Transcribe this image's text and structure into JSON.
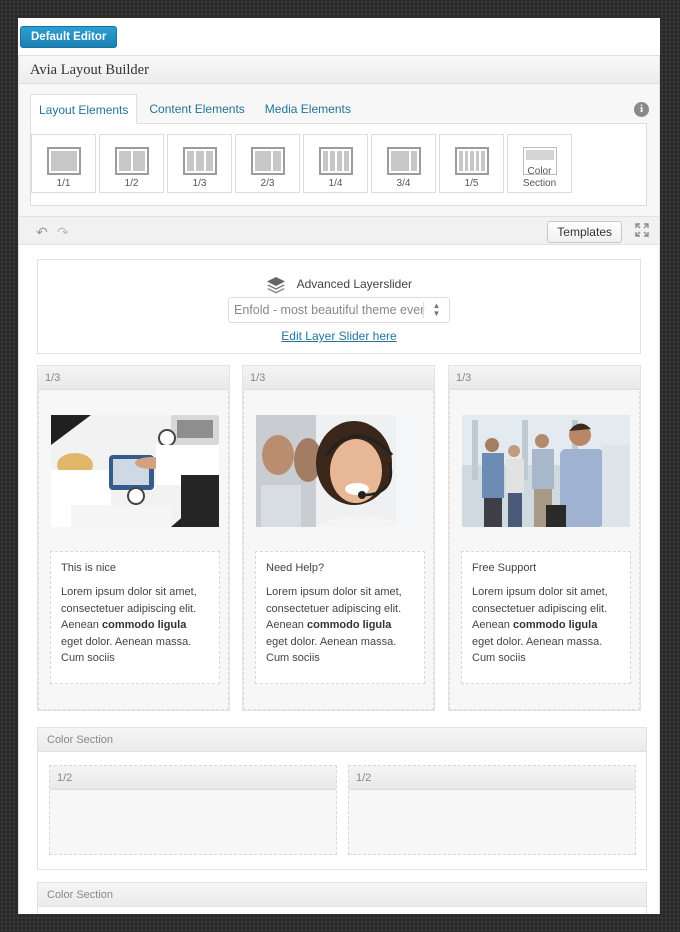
{
  "editor": {
    "default_editor_label": "Default Editor"
  },
  "builder": {
    "title": "Avia Layout Builder",
    "tabs": [
      {
        "label": "Layout Elements",
        "active": true
      },
      {
        "label": "Content Elements",
        "active": false
      },
      {
        "label": "Media Elements",
        "active": false
      }
    ],
    "info_icon": "i",
    "shortcodes": [
      {
        "label": "1/1",
        "icon": "layout-1-1-icon",
        "cols": 1
      },
      {
        "label": "1/2",
        "icon": "layout-1-2-icon",
        "cols": 2
      },
      {
        "label": "1/3",
        "icon": "layout-1-3-icon",
        "cols": 3
      },
      {
        "label": "2/3",
        "icon": "layout-2-3-icon",
        "cols": 2
      },
      {
        "label": "1/4",
        "icon": "layout-1-4-icon",
        "cols": 4
      },
      {
        "label": "3/4",
        "icon": "layout-3-4-icon",
        "cols": 1
      },
      {
        "label": "1/5",
        "icon": "layout-1-5-icon",
        "cols": 5
      },
      {
        "label_line1": "Color",
        "label_line2": "Section",
        "icon": "color-section-icon"
      }
    ]
  },
  "toolbar": {
    "templates_label": "Templates",
    "undo_icon": "↶",
    "redo_icon": "↷"
  },
  "canvas": {
    "layerslider": {
      "title": "Advanced Layerslider",
      "selected": "Enfold - most beautiful theme ever",
      "edit_link": "Edit Layer Slider here"
    },
    "columns": [
      {
        "head": "1/3",
        "image": "business-meeting-photo",
        "title": "This is nice",
        "body_pre": "Lorem ipsum dolor sit amet, consectetuer adipiscing elit. Aenean ",
        "body_bold": "commodo ligula",
        "body_post": " eget dolor. Aenean massa. Cum sociis"
      },
      {
        "head": "1/3",
        "image": "headset-support-photo",
        "title": "Need Help?",
        "body_pre": "Lorem ipsum dolor sit amet, consectetuer adipiscing elit. Aenean ",
        "body_bold": "commodo ligula",
        "body_post": " eget dolor. Aenean massa. Cum sociis"
      },
      {
        "head": "1/3",
        "image": "office-team-photo",
        "title": "Free Support",
        "body_pre": "Lorem ipsum dolor sit amet, consectetuer adipiscing elit. Aenean ",
        "body_bold": "commodo ligula",
        "body_post": " eget dolor. Aenean massa. Cum sociis"
      }
    ],
    "color_sections": [
      {
        "head": "Color Section",
        "cells": [
          "1/2",
          "1/2"
        ]
      },
      {
        "head": "Color Section"
      }
    ]
  },
  "colors": {
    "accent": "#21759b",
    "button_blue": "#1e88bf"
  }
}
